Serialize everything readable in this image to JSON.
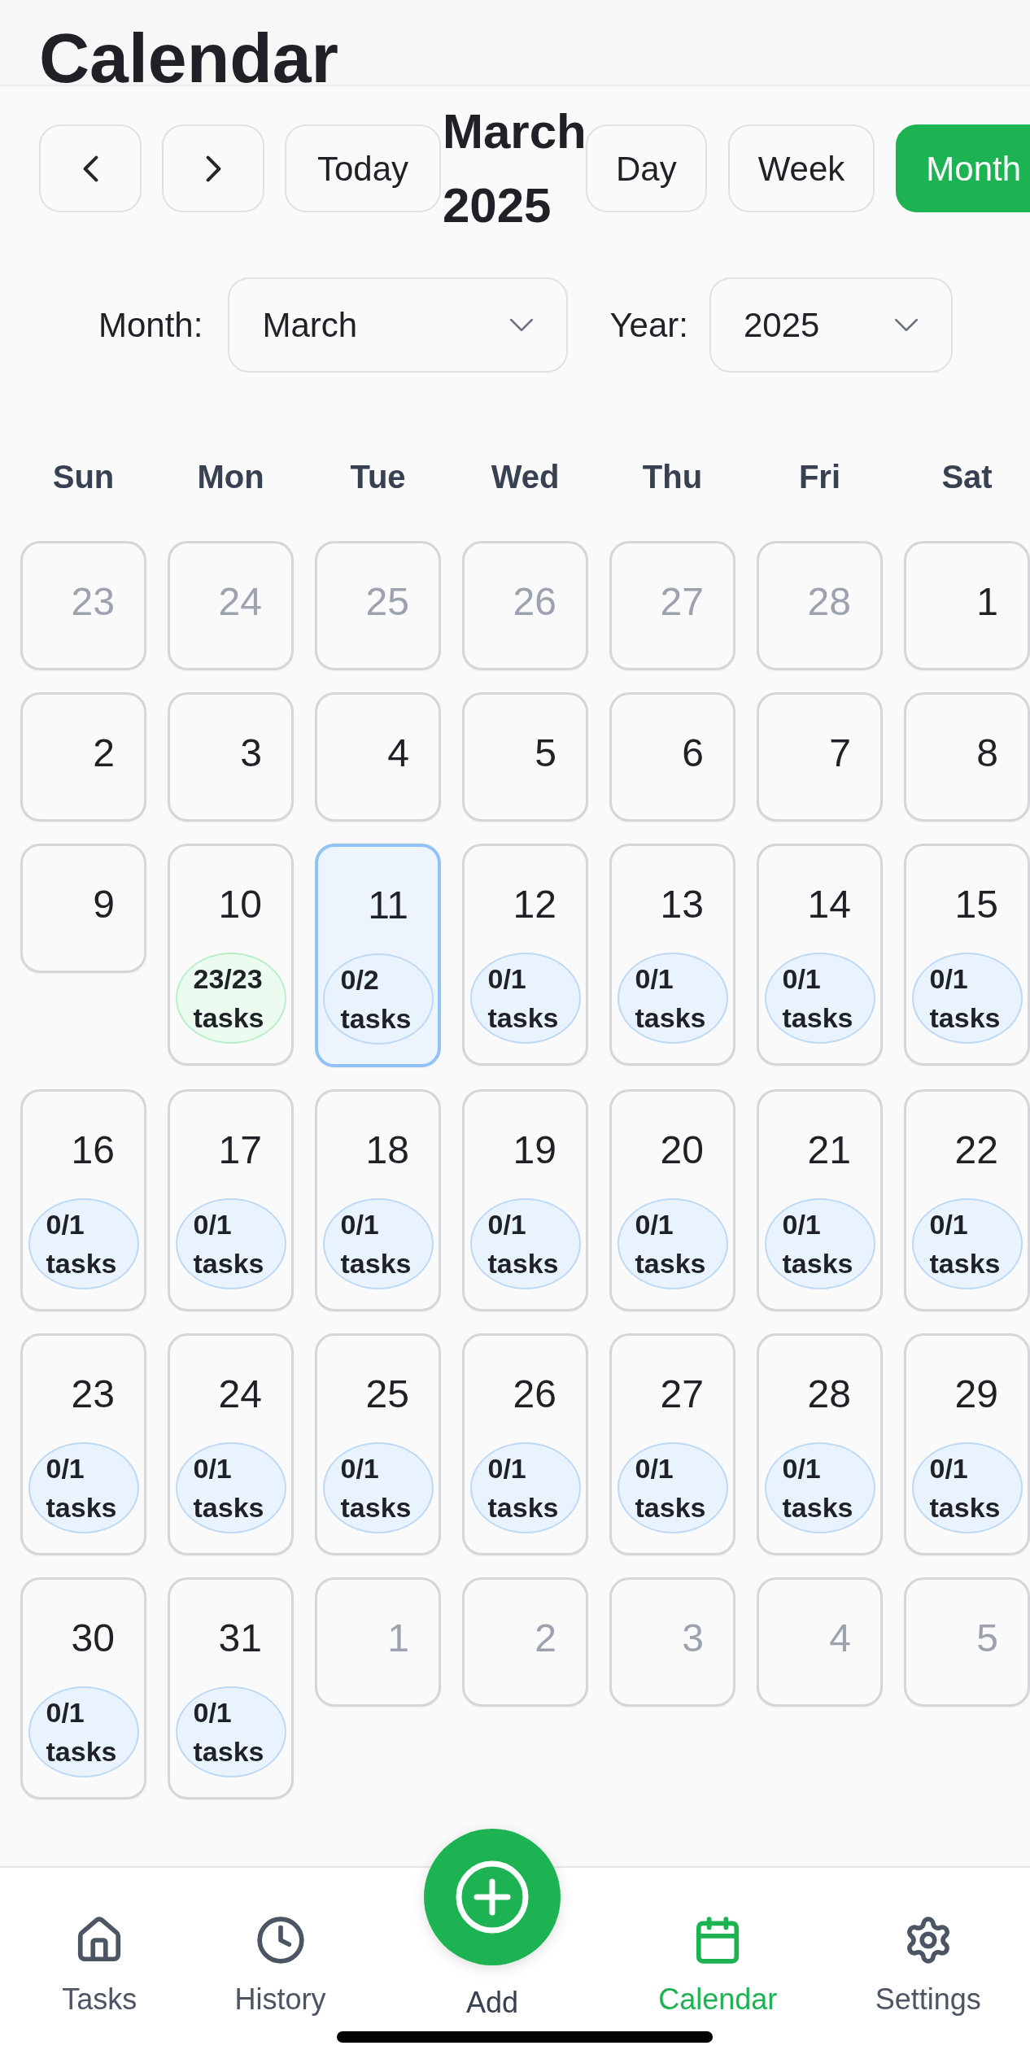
{
  "header": {
    "title": "Calendar"
  },
  "toolbar": {
    "today": "Today",
    "period_title": "March 2025",
    "views": [
      {
        "label": "Day",
        "selected": false
      },
      {
        "label": "Week",
        "selected": false
      },
      {
        "label": "Month",
        "selected": true
      }
    ]
  },
  "pickers": {
    "month": {
      "label": "Month:",
      "value": "March"
    },
    "year": {
      "label": "Year:",
      "value": "2025"
    }
  },
  "calendar": {
    "weekdays": [
      "Sun",
      "Mon",
      "Tue",
      "Wed",
      "Thu",
      "Fri",
      "Sat"
    ],
    "weeks": [
      [
        {
          "day": "23",
          "in_month": false,
          "selected": false
        },
        {
          "day": "24",
          "in_month": false,
          "selected": false
        },
        {
          "day": "25",
          "in_month": false,
          "selected": false
        },
        {
          "day": "26",
          "in_month": false,
          "selected": false
        },
        {
          "day": "27",
          "in_month": false,
          "selected": false
        },
        {
          "day": "28",
          "in_month": false,
          "selected": false
        },
        {
          "day": "1",
          "in_month": true,
          "selected": false
        }
      ],
      [
        {
          "day": "2",
          "in_month": true,
          "selected": false
        },
        {
          "day": "3",
          "in_month": true,
          "selected": false
        },
        {
          "day": "4",
          "in_month": true,
          "selected": false
        },
        {
          "day": "5",
          "in_month": true,
          "selected": false
        },
        {
          "day": "6",
          "in_month": true,
          "selected": false
        },
        {
          "day": "7",
          "in_month": true,
          "selected": false
        },
        {
          "day": "8",
          "in_month": true,
          "selected": false
        }
      ],
      [
        {
          "day": "9",
          "in_month": true,
          "selected": false
        },
        {
          "day": "10",
          "in_month": true,
          "selected": false,
          "tasks": {
            "text": "23/23 tasks",
            "complete": true
          }
        },
        {
          "day": "11",
          "in_month": true,
          "selected": true,
          "tasks": {
            "text": "0/2 tasks",
            "complete": false
          }
        },
        {
          "day": "12",
          "in_month": true,
          "selected": false,
          "tasks": {
            "text": "0/1 tasks",
            "complete": false
          }
        },
        {
          "day": "13",
          "in_month": true,
          "selected": false,
          "tasks": {
            "text": "0/1 tasks",
            "complete": false
          }
        },
        {
          "day": "14",
          "in_month": true,
          "selected": false,
          "tasks": {
            "text": "0/1 tasks",
            "complete": false
          }
        },
        {
          "day": "15",
          "in_month": true,
          "selected": false,
          "tasks": {
            "text": "0/1 tasks",
            "complete": false
          }
        }
      ],
      [
        {
          "day": "16",
          "in_month": true,
          "selected": false,
          "tasks": {
            "text": "0/1 tasks",
            "complete": false
          }
        },
        {
          "day": "17",
          "in_month": true,
          "selected": false,
          "tasks": {
            "text": "0/1 tasks",
            "complete": false
          }
        },
        {
          "day": "18",
          "in_month": true,
          "selected": false,
          "tasks": {
            "text": "0/1 tasks",
            "complete": false
          }
        },
        {
          "day": "19",
          "in_month": true,
          "selected": false,
          "tasks": {
            "text": "0/1 tasks",
            "complete": false
          }
        },
        {
          "day": "20",
          "in_month": true,
          "selected": false,
          "tasks": {
            "text": "0/1 tasks",
            "complete": false
          }
        },
        {
          "day": "21",
          "in_month": true,
          "selected": false,
          "tasks": {
            "text": "0/1 tasks",
            "complete": false
          }
        },
        {
          "day": "22",
          "in_month": true,
          "selected": false,
          "tasks": {
            "text": "0/1 tasks",
            "complete": false
          }
        }
      ],
      [
        {
          "day": "23",
          "in_month": true,
          "selected": false,
          "tasks": {
            "text": "0/1 tasks",
            "complete": false
          }
        },
        {
          "day": "24",
          "in_month": true,
          "selected": false,
          "tasks": {
            "text": "0/1 tasks",
            "complete": false
          }
        },
        {
          "day": "25",
          "in_month": true,
          "selected": false,
          "tasks": {
            "text": "0/1 tasks",
            "complete": false
          }
        },
        {
          "day": "26",
          "in_month": true,
          "selected": false,
          "tasks": {
            "text": "0/1 tasks",
            "complete": false
          }
        },
        {
          "day": "27",
          "in_month": true,
          "selected": false,
          "tasks": {
            "text": "0/1 tasks",
            "complete": false
          }
        },
        {
          "day": "28",
          "in_month": true,
          "selected": false,
          "tasks": {
            "text": "0/1 tasks",
            "complete": false
          }
        },
        {
          "day": "29",
          "in_month": true,
          "selected": false,
          "tasks": {
            "text": "0/1 tasks",
            "complete": false
          }
        }
      ],
      [
        {
          "day": "30",
          "in_month": true,
          "selected": false,
          "tasks": {
            "text": "0/1 tasks",
            "complete": false
          }
        },
        {
          "day": "31",
          "in_month": true,
          "selected": false,
          "tasks": {
            "text": "0/1 tasks",
            "complete": false
          }
        },
        {
          "day": "1",
          "in_month": false,
          "selected": false
        },
        {
          "day": "2",
          "in_month": false,
          "selected": false
        },
        {
          "day": "3",
          "in_month": false,
          "selected": false
        },
        {
          "day": "4",
          "in_month": false,
          "selected": false
        },
        {
          "day": "5",
          "in_month": false,
          "selected": false
        }
      ]
    ]
  },
  "nav": {
    "items": [
      {
        "label": "Tasks",
        "kind": "tab",
        "selected": false
      },
      {
        "label": "History",
        "kind": "tab",
        "selected": false
      },
      {
        "label": "Add",
        "kind": "action",
        "selected": false
      },
      {
        "label": "Calendar",
        "kind": "tab",
        "selected": true
      },
      {
        "label": "Settings",
        "kind": "tab",
        "selected": false
      }
    ]
  }
}
